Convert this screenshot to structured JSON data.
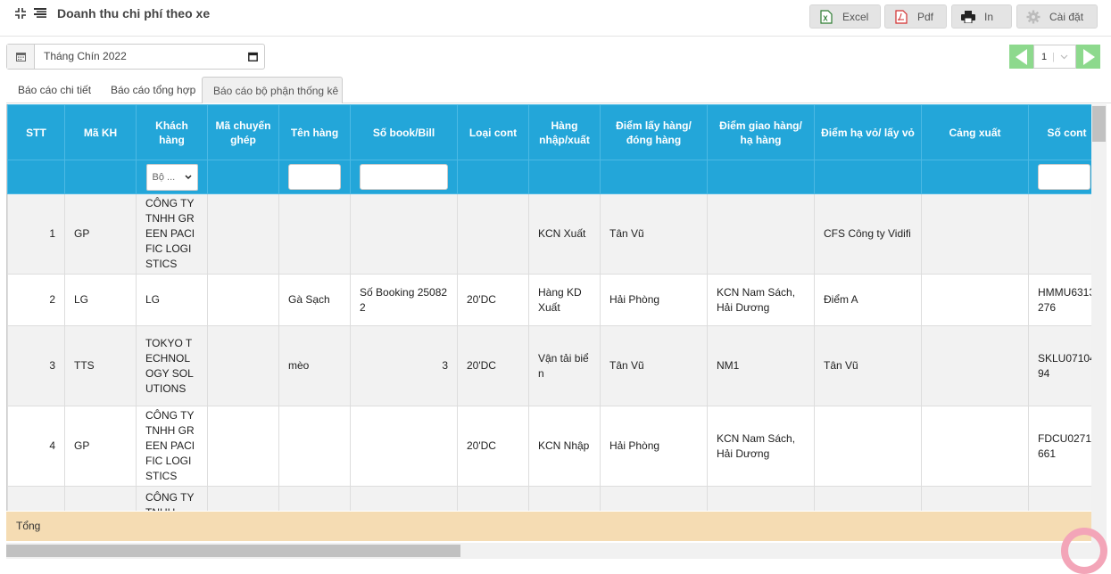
{
  "header": {
    "title": "Doanh thu chi phí theo xe"
  },
  "toolbar": {
    "excel": "Excel",
    "pdf": "Pdf",
    "print": "In",
    "settings": "Cài đặt"
  },
  "date_filter": {
    "value": "Tháng Chín 2022"
  },
  "pager": {
    "page": "1"
  },
  "tabs": [
    {
      "label": "Báo cáo chi tiết"
    },
    {
      "label": "Báo cáo tổng hợp"
    },
    {
      "label": "Báo cáo bộ phận thống kê"
    }
  ],
  "table": {
    "columns": [
      "STT",
      "Mã KH",
      "Khách hàng",
      "Mã chuyến ghép",
      "Tên hàng",
      "Số book/Bill",
      "Loại cont",
      "Hàng nhập/xuất",
      "Điểm lấy hàng/ đóng hàng",
      "Điểm giao hàng/ hạ hàng",
      "Điểm hạ vỏ/ lấy vỏ",
      "Cảng xuất",
      "Số cont"
    ],
    "customer_filter": "Bộ ...",
    "rows": [
      [
        "1",
        "GP",
        "CÔNG TY TNHH GREEN PACIFIC LOGISTICS",
        "",
        "",
        "",
        "",
        "KCN Xuất",
        "Tân Vũ",
        "",
        "CFS Công ty Vidifi",
        "",
        ""
      ],
      [
        "2",
        "LG",
        "LG",
        "",
        "Gà Sạch",
        "Số Booking 250822",
        "20'DC",
        "Hàng KD Xuất",
        "Hải Phòng",
        "KCN Nam Sách, Hải Dương",
        "Điểm A",
        "",
        "HMMU6313276"
      ],
      [
        "3",
        "TTS",
        "TOKYO TECHNOLOGY SOLUTIONS",
        "",
        "mèo",
        "3",
        "20'DC",
        "Vận tải biển",
        "Tân Vũ",
        "NM1",
        "Tân Vũ",
        "",
        "SKLU0710494"
      ],
      [
        "4",
        "GP",
        "CÔNG TY TNHH GREEN PACIFIC LOGISTICS",
        "",
        "",
        "",
        "20'DC",
        "KCN Nhập",
        "Hải Phòng",
        "KCN Nam Sách, Hải Dương",
        "",
        "",
        "FDCU0271661"
      ],
      [
        "",
        "",
        "CÔNG TY TNHH",
        "",
        "",
        "",
        "",
        "",
        "",
        "",
        "",
        "",
        ""
      ]
    ]
  },
  "footer": {
    "total_label": "Tổng"
  }
}
